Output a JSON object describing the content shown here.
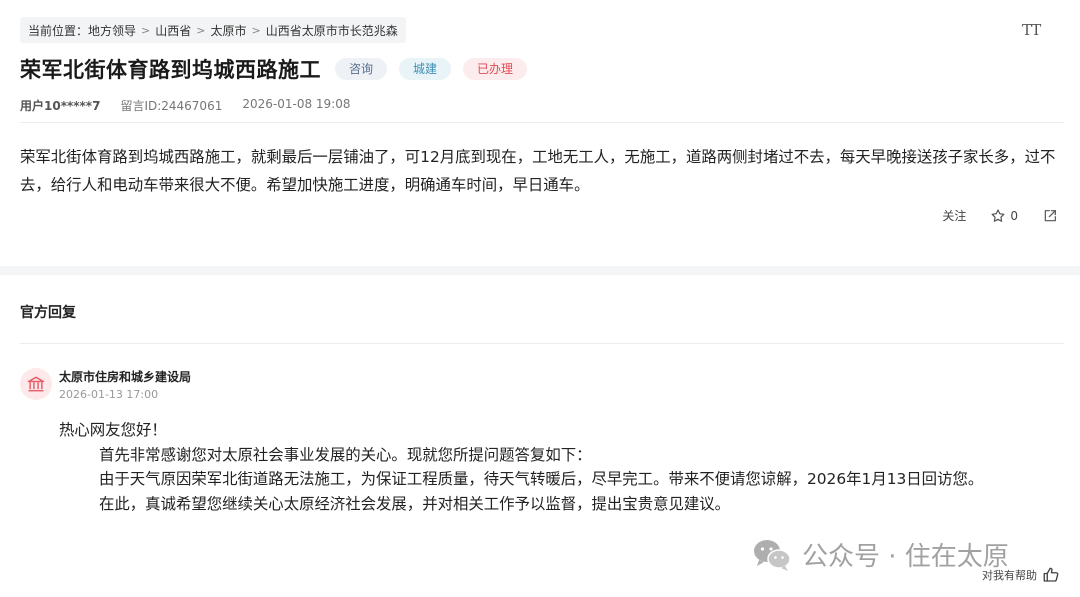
{
  "breadcrumb": {
    "prefix": "当前位置：",
    "items": [
      "地方领导",
      "山西省",
      "太原市",
      "山西省太原市市长范兆森"
    ],
    "separator": ">"
  },
  "font_toggle": {
    "label": "TT"
  },
  "post": {
    "title": "荣军北街体育路到坞城西路施工",
    "tags": [
      {
        "label": "咨询"
      },
      {
        "label": "城建"
      },
      {
        "label": "已办理"
      }
    ],
    "user": "用户10*****7",
    "message_id": "留言ID:24467061",
    "date": "2026-01-08 19:08",
    "content": "荣军北街体育路到坞城西路施工，就剩最后一层铺油了，可12月底到现在，工地无工人，无施工，道路两侧封堵过不去，每天早晚接送孩子家长多，过不去，给行人和电动车带来很大不便。希望加快施工进度，明确通车时间，早日通车。",
    "actions": {
      "follow_label": "关注",
      "like_count": "0"
    }
  },
  "official_reply": {
    "section_title": "官方回复",
    "org_name": "太原市住房和城乡建设局",
    "time": "2026-01-13 17:00",
    "greeting": "热心网友您好！",
    "paragraphs": [
      "首先非常感谢您对太原社会事业发展的关心。现就您所提问题答复如下：",
      "由于天气原因荣军北街道路无法施工，为保证工程质量，待天气转暖后，尽早完工。带来不便请您谅解，2026年1月13日回访您。",
      "在此，真诚希望您继续关心太原经济社会发展，并对相关工作予以监督，提出宝贵意见建议。"
    ],
    "helpful_label": "对我有帮助"
  },
  "watermark": {
    "text": "公众号 · 住在太原"
  },
  "colors": {
    "tag_consult": "#5a6f8c",
    "tag_city": "#3c8fb5",
    "tag_done": "#e04b55",
    "org_icon": "#e8606a"
  }
}
